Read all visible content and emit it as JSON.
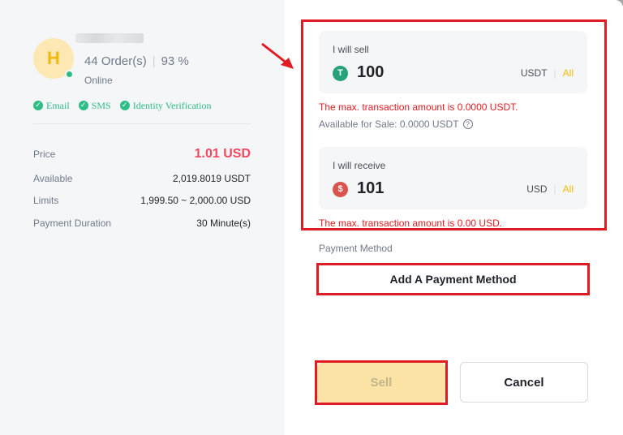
{
  "merchant": {
    "avatar_letter": "H",
    "orders": "44 Order(s)",
    "completion": "93 %",
    "status": "Online",
    "verifications": [
      "Email",
      "SMS",
      "Identity Verification"
    ]
  },
  "details": {
    "price_label": "Price",
    "price_value": "1.01 USD",
    "available_label": "Available",
    "available_value": "2,019.8019 USDT",
    "limits_label": "Limits",
    "limits_value": "1,999.50 ~ 2,000.00 USD",
    "duration_label": "Payment Duration",
    "duration_value": "30 Minute(s)"
  },
  "sell_field": {
    "label": "I will sell",
    "coin_symbol": "T",
    "amount": "100",
    "unit": "USDT",
    "all": "All",
    "error": "The max. transaction amount is 0.0000 USDT.",
    "available_for_sale": "Available for Sale: 0.0000 USDT"
  },
  "receive_field": {
    "label": "I will receive",
    "coin_symbol": "$",
    "amount": "101",
    "unit": "USD",
    "all": "All",
    "error": "The max. transaction amount is 0.00 USD."
  },
  "payment": {
    "label": "Payment Method",
    "add_button": "Add A Payment Method"
  },
  "actions": {
    "sell": "Sell",
    "cancel": "Cancel"
  },
  "colors": {
    "accent": "#f0b90b",
    "success": "#2ebd85",
    "error": "#e11b22",
    "price": "#f6465d",
    "tether": "#26a17b",
    "usd": "#d9534f"
  }
}
